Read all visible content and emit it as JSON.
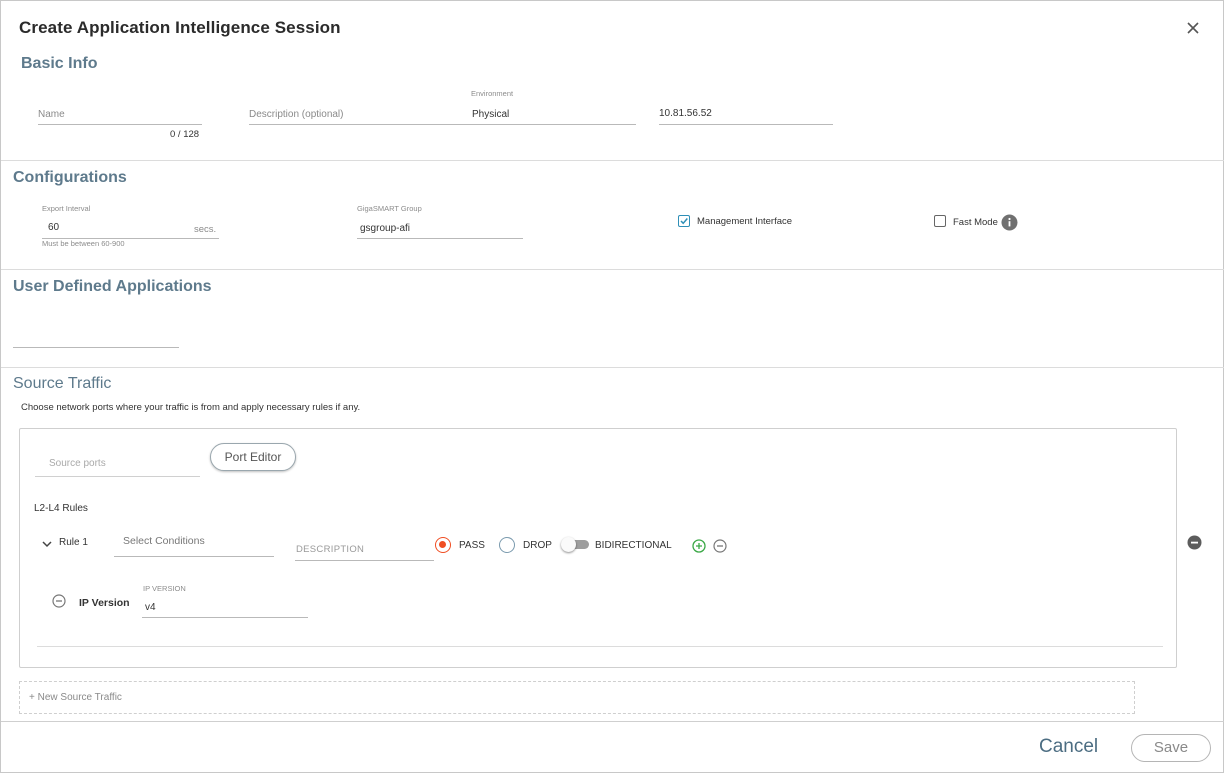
{
  "dialog": {
    "title": "Create Application Intelligence Session"
  },
  "basic_info": {
    "title": "Basic Info",
    "name": {
      "placeholder": "Name",
      "counter": "0 / 128"
    },
    "description": {
      "placeholder": "Description (optional)"
    },
    "environment": {
      "label": "Environment",
      "value": "Physical"
    },
    "ip": {
      "value": "10.81.56.52"
    }
  },
  "configurations": {
    "title": "Configurations",
    "export_interval": {
      "label": "Export Interval",
      "value": "60",
      "unit": "secs.",
      "hint": "Must be between 60-900"
    },
    "gigasmart_group": {
      "label": "GigaSMART Group",
      "value": "gsgroup-afi"
    },
    "management_interface": {
      "label": "Management Interface",
      "checked": true
    },
    "fast_mode": {
      "label": "Fast Mode",
      "checked": false
    }
  },
  "user_defined_apps": {
    "title": "User Defined Applications"
  },
  "source_traffic": {
    "title": "Source Traffic",
    "description": "Choose network ports where your traffic is from and apply necessary rules if any.",
    "source_ports_placeholder": "Source ports",
    "port_editor_label": "Port Editor",
    "rules_title": "L2-L4 Rules",
    "rule": {
      "label": "Rule 1",
      "conditions_placeholder": "Select Conditions",
      "description_placeholder": "DESCRIPTION",
      "pass_label": "PASS",
      "drop_label": "DROP",
      "bidirectional_label": "BIDIRECTIONAL",
      "selected_action": "PASS",
      "bidirectional_on": false,
      "condition": {
        "label": "IP Version",
        "field_label": "IP VERSION",
        "value": "v4"
      }
    },
    "new_source_label": "+ New Source Traffic"
  },
  "footer": {
    "cancel_label": "Cancel",
    "save_label": "Save"
  },
  "colors": {
    "accent": "#5e7a8c",
    "radio_selected": "#f04e23",
    "add_green": "#3aa846",
    "checkbox_blue": "#2f8fb7"
  }
}
